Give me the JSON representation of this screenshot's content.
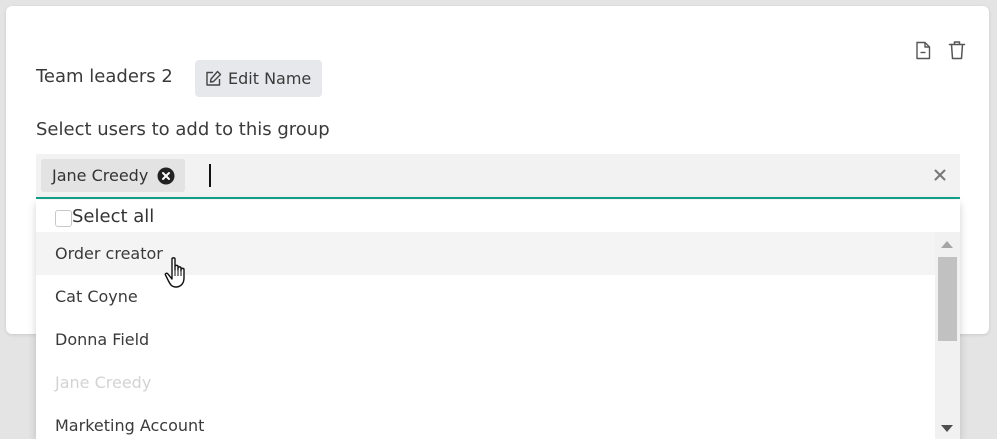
{
  "group": {
    "name": "Team leaders 2",
    "edit_label": "Edit Name"
  },
  "selector": {
    "label": "Select users to add to this group",
    "selected_chip": "Jane Creedy",
    "select_all_label": "Select all",
    "options": [
      {
        "label": "Order creator",
        "state": "hover"
      },
      {
        "label": "Cat Coyne",
        "state": "normal"
      },
      {
        "label": "Donna Field",
        "state": "normal"
      },
      {
        "label": "Jane Creedy",
        "state": "disabled"
      },
      {
        "label": "Marketing Account",
        "state": "normal"
      }
    ]
  },
  "colors": {
    "accent": "#14a08a",
    "disabled_text": "#d3d3d3"
  },
  "icons": {
    "document": "document-icon",
    "delete": "trash-icon",
    "edit": "pencil-square-icon",
    "chip_remove": "circle-x-icon",
    "clear": "close-icon",
    "pointer": "hand-pointer-cursor"
  }
}
